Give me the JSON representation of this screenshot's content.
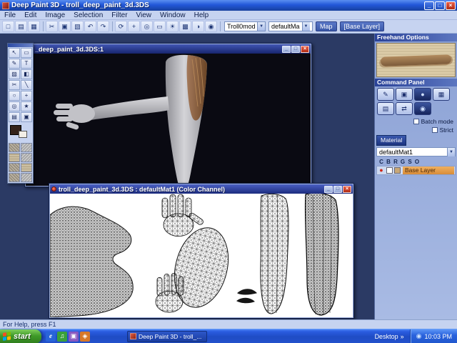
{
  "titlebar": {
    "title": "Deep Paint 3D - troll_deep_paint_3d.3DS"
  },
  "icons": {
    "minimize": "_",
    "maximize": "□",
    "close": "×",
    "combo_arrow": "▼",
    "toolbar1": [
      "□",
      "▤",
      "▦",
      "✂",
      "▣",
      "▧",
      "↶",
      "↷"
    ],
    "toolbar2": [
      "⟳",
      "+",
      "◎",
      "▭",
      "☀",
      "▩",
      "◑",
      "◉"
    ],
    "tools": [
      "↖",
      "▭",
      "✎",
      "T",
      "▨",
      "◧",
      "✂",
      "╲",
      "○",
      "+",
      "◎",
      "★",
      "▤",
      "▣"
    ],
    "command_row1": [
      "✎",
      "▣",
      "●",
      "▦"
    ],
    "command_row2": [
      "▤",
      "⇄",
      "◉"
    ],
    "quick_launch": [
      "e",
      "♫",
      "▣",
      "◈"
    ],
    "tray_icon": "◉",
    "layer_ball": "●",
    "desktop_chevron": "»"
  },
  "menubar": {
    "items": [
      "File",
      "Edit",
      "Image",
      "Selection",
      "Filter",
      "View",
      "Window",
      "Help"
    ]
  },
  "toolbar": {
    "model_combo": "Troll0mod",
    "material_combo": "defaultMa",
    "map_button": "Map",
    "layer_indicator": "[Base Layer]"
  },
  "windows": {
    "view3d": {
      "title": "_deep_paint_3d.3DS:1"
    },
    "uv": {
      "title": "troll_deep_paint_3d.3DS : defaultMat1 (Color Channel)"
    }
  },
  "right_panel": {
    "freehand_header": "Freehand Options",
    "command_header": "Command Panel",
    "material_label": "Material",
    "material_value": "defaultMat1",
    "batch_mode_label": "Batch mode",
    "strict_label": "Strict",
    "layer_columns": [
      "C",
      "B",
      "R",
      "G",
      "S",
      "O"
    ],
    "base_layer_label": "Base Layer"
  },
  "statusbar": {
    "help_text": "For Help, press F1"
  },
  "taskbar": {
    "start_label": "start",
    "task_button_label": "Deep Paint 3D - troll_...",
    "desktop_label": "Desktop",
    "time": "10:03 PM"
  }
}
